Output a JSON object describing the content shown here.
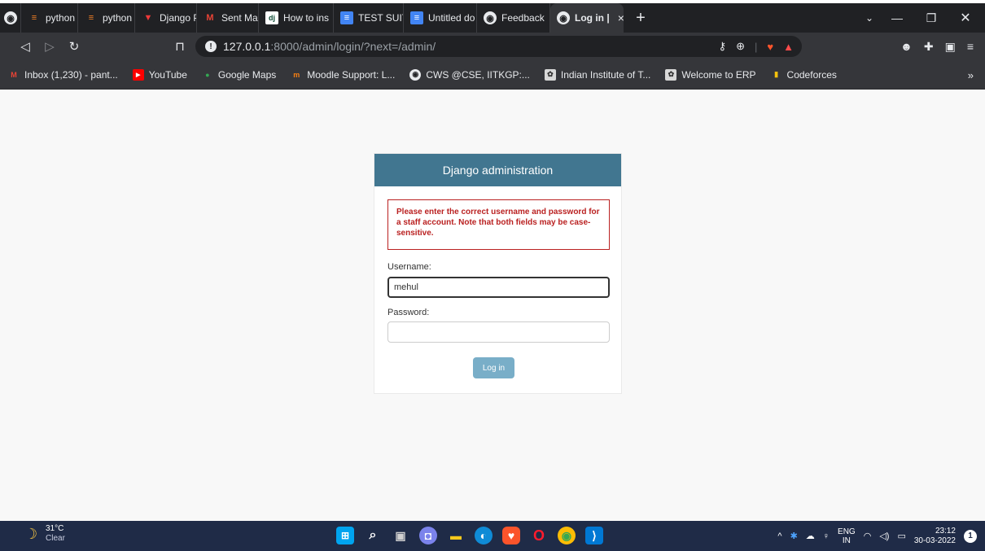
{
  "browser": {
    "tabs": [
      {
        "label": "python - D",
        "icon": "stackoverflow-icon"
      },
      {
        "label": "python - D",
        "icon": "stackoverflow-icon"
      },
      {
        "label": "Django PD",
        "icon": "vivaldi-icon"
      },
      {
        "label": "Sent Mail -",
        "icon": "gmail-icon"
      },
      {
        "label": "How to ins",
        "icon": "django-icon"
      },
      {
        "label": "TEST SUITE",
        "icon": "docs-icon"
      },
      {
        "label": "Untitled do",
        "icon": "docs-icon"
      },
      {
        "label": "Feedback",
        "icon": "globe-icon"
      }
    ],
    "active_tab": {
      "label": "Log in |",
      "close": "×"
    },
    "address": {
      "host": "127.0.0.1",
      "rest": ":8000/admin/login/?next=/admin/"
    },
    "bookmarks": [
      {
        "label": "Inbox (1,230) - pant...",
        "icon": "gmail-icon"
      },
      {
        "label": "YouTube",
        "icon": "youtube-icon"
      },
      {
        "label": "Google Maps",
        "icon": "maps-icon"
      },
      {
        "label": "Moodle Support: L...",
        "icon": "moodle-icon"
      },
      {
        "label": "CWS @CSE, IITKGP:...",
        "icon": "globe-icon"
      },
      {
        "label": "Indian Institute of T...",
        "icon": "iit-icon"
      },
      {
        "label": "Welcome to ERP",
        "icon": "iit-icon"
      },
      {
        "label": "Codeforces",
        "icon": "codeforces-icon"
      }
    ],
    "bookmarks_more": "»"
  },
  "login": {
    "header": "Django administration",
    "error": "Please enter the correct username and password for a staff account. Note that both fields may be case-sensitive.",
    "username_label": "Username:",
    "username_value": "mehul",
    "password_label": "Password:",
    "password_value": "",
    "submit_label": "Log in"
  },
  "taskbar": {
    "weather_temp": "31°C",
    "weather_desc": "Clear",
    "lang_top": "ENG",
    "lang_bottom": "IN",
    "time": "23:12",
    "date": "30-03-2022",
    "notification_count": "1"
  },
  "colors": {
    "django_header": "#417690",
    "error": "#ba2121",
    "button": "#79aec8",
    "taskbar": "#1f2b47"
  }
}
